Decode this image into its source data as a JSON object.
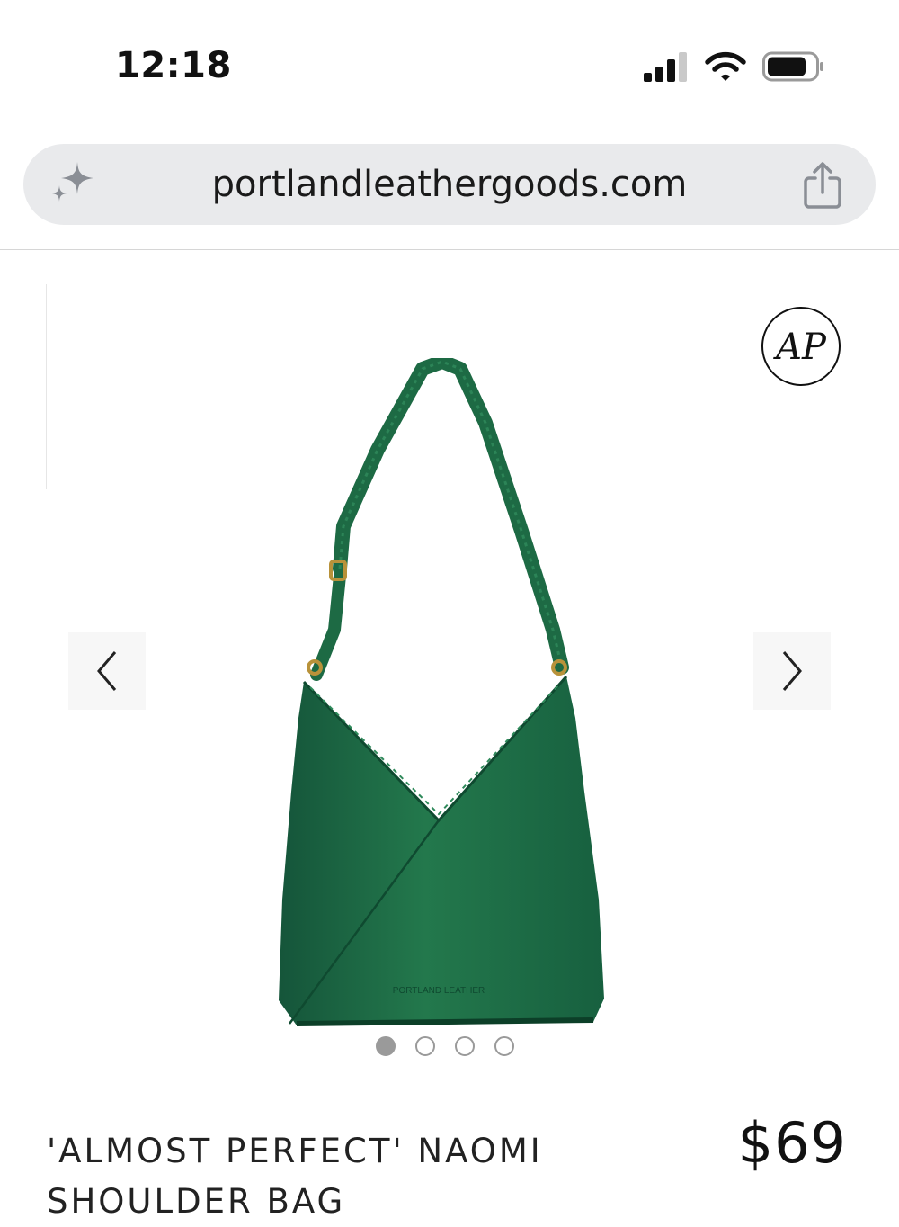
{
  "status": {
    "time": "12:18"
  },
  "browser": {
    "url": "portlandleathergoods.com"
  },
  "product": {
    "brand_badge": "AP",
    "image_stamp": "PORTLAND LEATHER",
    "title": "'ALMOST PERFECT' NAOMI SHOULDER BAG",
    "price": "$69",
    "image_count": 4,
    "active_image": 1,
    "color": "#1f6b43"
  },
  "icons": {
    "sparkle": "sparkle-icon",
    "share": "share-icon",
    "prev": "chevron-left-icon",
    "next": "chevron-right-icon"
  }
}
